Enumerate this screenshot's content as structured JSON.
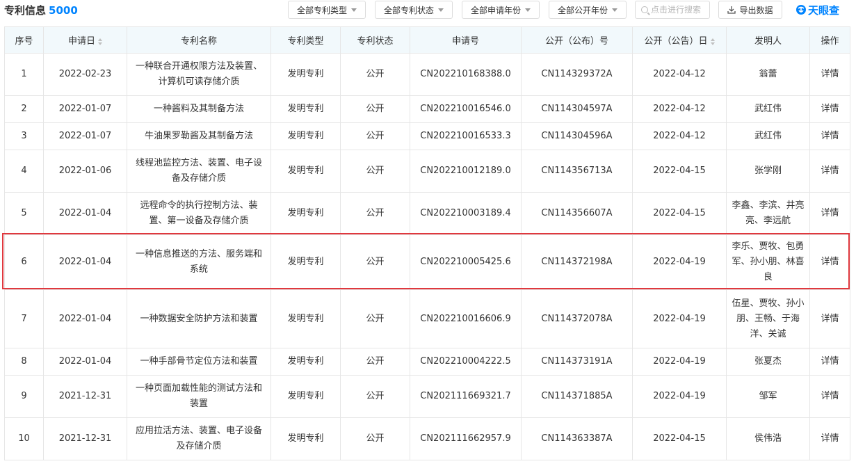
{
  "header": {
    "title": "专利信息",
    "count": "5000",
    "filters": [
      "全部专利类型",
      "全部专利状态",
      "全部申请年份",
      "全部公开年份"
    ],
    "search_placeholder": "点击进行搜索",
    "export_label": "导出数据",
    "brand": "天眼查"
  },
  "table": {
    "columns": [
      "序号",
      "申请日",
      "专利名称",
      "专利类型",
      "专利状态",
      "申请号",
      "公开（公布）号",
      "公开（公告）日",
      "发明人",
      "操作"
    ],
    "rows": [
      {
        "index": "1",
        "apply_date": "2022-02-23",
        "name": "一种联合开通权限方法及装置、计算机可读存储介质",
        "type": "发明专利",
        "status": "公开",
        "app_no": "CN202210168388.0",
        "pub_no": "CN114329372A",
        "pub_date": "2022-04-12",
        "inventor": "翁蕾",
        "op": "详情"
      },
      {
        "index": "2",
        "apply_date": "2022-01-07",
        "name": "一种酱料及其制备方法",
        "type": "发明专利",
        "status": "公开",
        "app_no": "CN202210016546.0",
        "pub_no": "CN114304597A",
        "pub_date": "2022-04-12",
        "inventor": "武红伟",
        "op": "详情"
      },
      {
        "index": "3",
        "apply_date": "2022-01-07",
        "name": "牛油果罗勒酱及其制备方法",
        "type": "发明专利",
        "status": "公开",
        "app_no": "CN202210016533.3",
        "pub_no": "CN114304596A",
        "pub_date": "2022-04-12",
        "inventor": "武红伟",
        "op": "详情"
      },
      {
        "index": "4",
        "apply_date": "2022-01-06",
        "name": "线程池监控方法、装置、电子设备及存储介质",
        "type": "发明专利",
        "status": "公开",
        "app_no": "CN202210012189.0",
        "pub_no": "CN114356713A",
        "pub_date": "2022-04-15",
        "inventor": "张学刚",
        "op": "详情"
      },
      {
        "index": "5",
        "apply_date": "2022-01-04",
        "name": "远程命令的执行控制方法、装置、第一设备及存储介质",
        "type": "发明专利",
        "status": "公开",
        "app_no": "CN202210003189.4",
        "pub_no": "CN114356607A",
        "pub_date": "2022-04-15",
        "inventor": "李鑫、李滨、井亮亮、李远航",
        "op": "详情"
      },
      {
        "index": "6",
        "apply_date": "2022-01-04",
        "name": "一种信息推送的方法、服务端和系统",
        "type": "发明专利",
        "status": "公开",
        "app_no": "CN202210005425.6",
        "pub_no": "CN114372198A",
        "pub_date": "2022-04-19",
        "inventor": "李乐、贾牧、包勇军、孙小朋、林喜良",
        "op": "详情"
      },
      {
        "index": "7",
        "apply_date": "2022-01-04",
        "name": "一种数据安全防护方法和装置",
        "type": "发明专利",
        "status": "公开",
        "app_no": "CN202210016606.9",
        "pub_no": "CN114372078A",
        "pub_date": "2022-04-19",
        "inventor": "伍星、贾牧、孙小朋、王畅、于海洋、关诚",
        "op": "详情"
      },
      {
        "index": "8",
        "apply_date": "2022-01-04",
        "name": "一种手部骨节定位方法和装置",
        "type": "发明专利",
        "status": "公开",
        "app_no": "CN202210004222.5",
        "pub_no": "CN114373191A",
        "pub_date": "2022-04-19",
        "inventor": "张夏杰",
        "op": "详情"
      },
      {
        "index": "9",
        "apply_date": "2021-12-31",
        "name": "一种页面加载性能的测试方法和装置",
        "type": "发明专利",
        "status": "公开",
        "app_no": "CN202111669321.7",
        "pub_no": "CN114371885A",
        "pub_date": "2022-04-19",
        "inventor": "邹军",
        "op": "详情"
      },
      {
        "index": "10",
        "apply_date": "2021-12-31",
        "name": "应用拉活方法、装置、电子设备及存储介质",
        "type": "发明专利",
        "status": "公开",
        "app_no": "CN202111662957.9",
        "pub_no": "CN114363387A",
        "pub_date": "2022-04-15",
        "inventor": "侯伟浩",
        "op": "详情"
      }
    ]
  },
  "colors": {
    "accent": "#0084ff",
    "status": "#9b66c6",
    "header_bg": "#f2f9fc",
    "highlight_border": "#e0383e"
  },
  "icons": {
    "search": "search-icon",
    "export": "download-icon",
    "brand": "tianyancha-logo-icon"
  }
}
